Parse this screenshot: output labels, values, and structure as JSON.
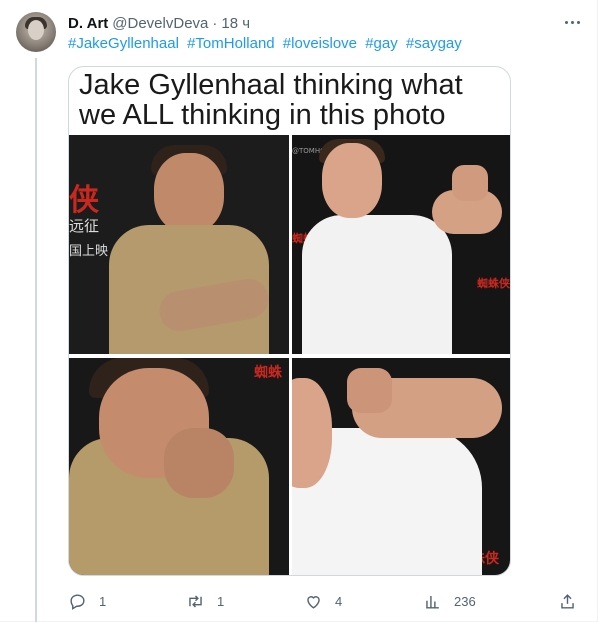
{
  "tweet": {
    "author_name": "D. Art",
    "handle": "@DevelvDeva",
    "separator": "·",
    "time": "18 ч",
    "hashtags": [
      "#JakeGyllenhaal",
      "#TomHolland",
      "#loveislove",
      "#gay",
      "#saygay"
    ]
  },
  "media": {
    "caption": "Jake Gyllenhaal thinking what we ALL thinking in this photo",
    "watermark": "@TOMHOLLANDYUPPERS"
  },
  "actions": {
    "replies": "1",
    "retweets": "1",
    "likes": "4",
    "views": "236"
  },
  "icons": {
    "more": "more-horizontal-icon",
    "reply": "reply-icon",
    "retweet": "retweet-icon",
    "like": "heart-icon",
    "views": "bar-chart-icon",
    "share": "share-icon"
  },
  "colors": {
    "link": "#1d9bf0",
    "muted": "#536471"
  }
}
